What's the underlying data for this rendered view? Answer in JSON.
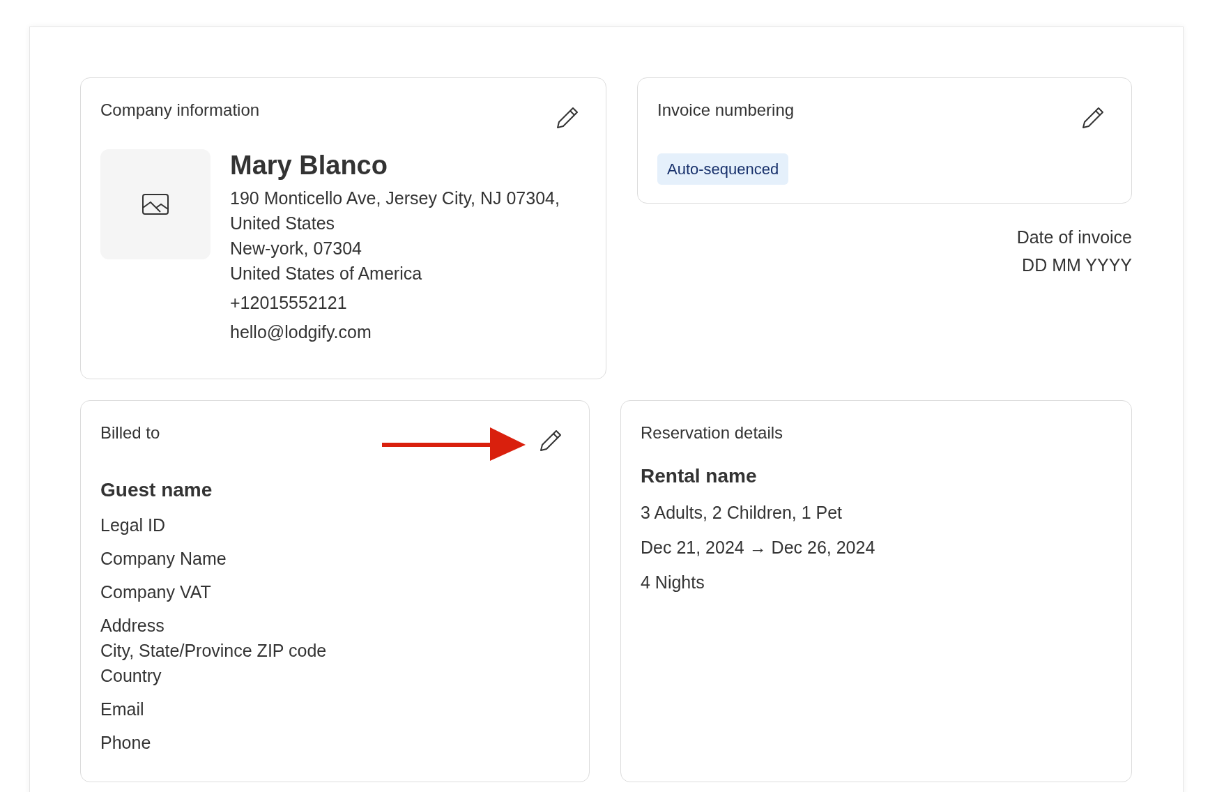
{
  "company": {
    "title": "Company information",
    "name": "Mary Blanco",
    "address_lines": [
      "190 Monticello Ave, Jersey City, NJ 07304,",
      "United States",
      "New-york, 07304",
      "United States of America"
    ],
    "phone": "+12015552121",
    "email": "hello@lodgify.com"
  },
  "invoice_numbering": {
    "title": "Invoice numbering",
    "badge": "Auto-sequenced"
  },
  "invoice_date": {
    "label": "Date of invoice",
    "value": "DD MM YYYY"
  },
  "billed_to": {
    "title": "Billed to",
    "name": "Guest name",
    "groups": [
      {
        "lines": [
          "Legal ID"
        ]
      },
      {
        "lines": [
          "Company Name"
        ]
      },
      {
        "lines": [
          "Company VAT"
        ]
      },
      {
        "lines": [
          "Address",
          "City, State/Province ZIP code",
          "Country"
        ]
      },
      {
        "lines": [
          "Email"
        ]
      },
      {
        "lines": [
          "Phone"
        ]
      }
    ]
  },
  "reservation": {
    "title": "Reservation details",
    "rental": "Rental name",
    "lines": [
      "3 Adults, 2 Children, 1 Pet",
      "Dec 21, 2024 → Dec 26, 2024",
      "4 Nights"
    ]
  }
}
